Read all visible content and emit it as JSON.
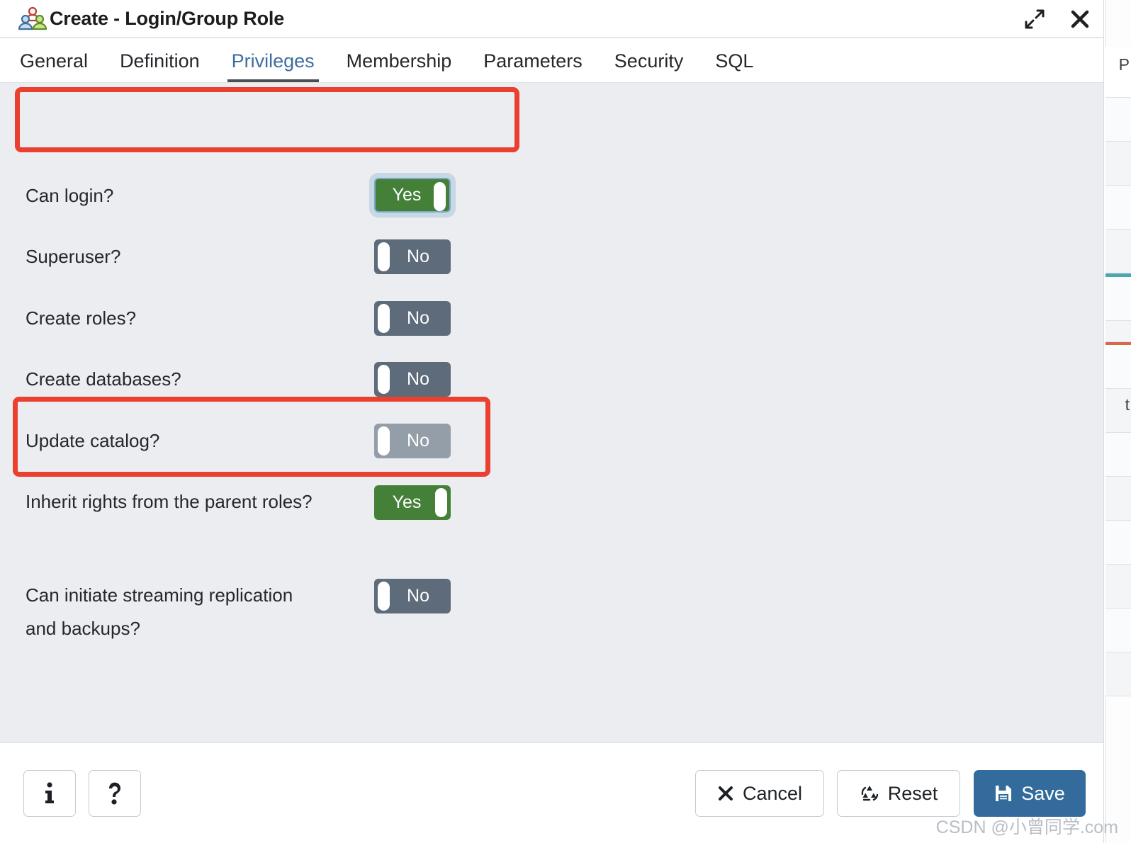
{
  "window": {
    "title": "Create - Login/Group Role",
    "icon": "group-role-icon",
    "controls": [
      {
        "name": "maximize",
        "label": "Maximize"
      },
      {
        "name": "close",
        "label": "Close"
      }
    ]
  },
  "tabs": [
    {
      "label": "General",
      "active": false
    },
    {
      "label": "Definition",
      "active": false
    },
    {
      "label": "Privileges",
      "active": true
    },
    {
      "label": "Membership",
      "active": false
    },
    {
      "label": "Parameters",
      "active": false
    },
    {
      "label": "Security",
      "active": false
    },
    {
      "label": "SQL",
      "active": false
    }
  ],
  "fields": [
    {
      "label": "Can login?",
      "value": "Yes",
      "state": "on",
      "focused": true,
      "disabled": false,
      "annotated": true
    },
    {
      "label": "Superuser?",
      "value": "No",
      "state": "off",
      "focused": false,
      "disabled": false,
      "annotated": false
    },
    {
      "label": "Create roles?",
      "value": "No",
      "state": "off",
      "focused": false,
      "disabled": false,
      "annotated": false
    },
    {
      "label": "Create databases?",
      "value": "No",
      "state": "off",
      "focused": false,
      "disabled": false,
      "annotated": false
    },
    {
      "label": "Update catalog?",
      "value": "No",
      "state": "off",
      "focused": false,
      "disabled": true,
      "annotated": false
    },
    {
      "label": "Inherit rights from the parent roles?",
      "value": "Yes",
      "state": "on",
      "focused": false,
      "disabled": false,
      "annotated": true
    },
    {
      "label": "Can initiate streaming replication and backups?",
      "value": "No",
      "state": "off",
      "focused": false,
      "disabled": false,
      "annotated": false
    }
  ],
  "footer": {
    "info_label": "i",
    "help_label": "?",
    "cancel_label": "Cancel",
    "reset_label": "Reset",
    "save_label": "Save"
  },
  "watermark": "CSDN @小曾同学.com",
  "colors": {
    "toggle_on": "#448038",
    "toggle_off": "#5d6b7a",
    "toggle_disabled": "#949ea9",
    "annotation": "#ea4030",
    "primary": "#336c9c",
    "active_tab_text": "#3d6f9e",
    "body_bg": "#ebedf0"
  }
}
